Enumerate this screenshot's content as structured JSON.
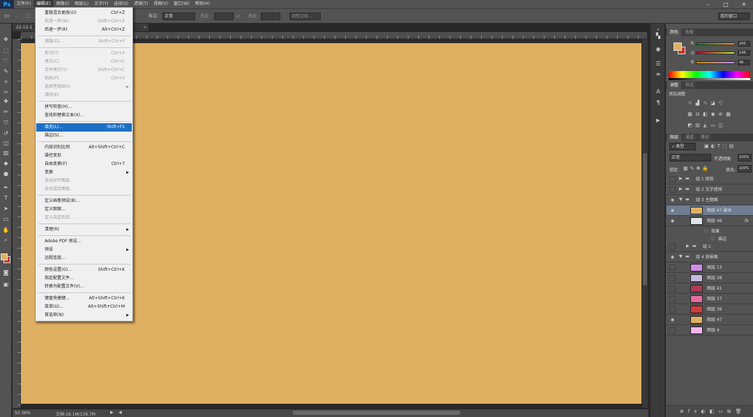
{
  "app": {
    "logo": "Ps"
  },
  "menubar": {
    "items": [
      "文件(F)",
      "编辑(E)",
      "图像(I)",
      "图层(L)",
      "文字(Y)",
      "选择(S)",
      "滤镜(T)",
      "视图(V)",
      "窗口(W)",
      "帮助(H)"
    ],
    "active_index": 1
  },
  "window_controls": [
    "–",
    "□",
    "✕"
  ],
  "options_bar": {
    "style_label": "样式:",
    "style_value": "正常",
    "width_label": "宽度:",
    "height_label": "高度:",
    "refine_label": "调整边缘...",
    "workspace": "我的窗口"
  },
  "document": {
    "tab_label": "22-12-1",
    "zoom": "50.36%",
    "info": "文档:16.1M/139.7M"
  },
  "edit_menu": {
    "sections": [
      [
        {
          "label": "重做混合更改(O)",
          "shortcut": "Ctrl+Z",
          "disabled": false
        },
        {
          "label": "前进一步(W)",
          "shortcut": "Shift+Ctrl+Z",
          "disabled": true
        },
        {
          "label": "后退一步(K)",
          "shortcut": "Alt+Ctrl+Z",
          "disabled": false
        }
      ],
      [
        {
          "label": "渐隐(D)...",
          "shortcut": "Shift+Ctrl+F",
          "disabled": true
        }
      ],
      [
        {
          "label": "剪切(T)",
          "shortcut": "Ctrl+X",
          "disabled": true
        },
        {
          "label": "拷贝(C)",
          "shortcut": "Ctrl+C",
          "disabled": true
        },
        {
          "label": "合并拷贝(Y)",
          "shortcut": "Shift+Ctrl+C",
          "disabled": true
        },
        {
          "label": "粘贴(P)",
          "shortcut": "Ctrl+V",
          "disabled": true
        },
        {
          "label": "选择性粘贴(I)",
          "shortcut": "",
          "submenu": true,
          "disabled": true
        },
        {
          "label": "清除(E)",
          "shortcut": "",
          "disabled": true
        }
      ],
      [
        {
          "label": "拼写检查(H)...",
          "shortcut": "",
          "disabled": false
        },
        {
          "label": "查找和替换文本(X)...",
          "shortcut": "",
          "disabled": false
        }
      ],
      [
        {
          "label": "填充(L)...",
          "shortcut": "Shift+F5",
          "disabled": false,
          "highlighted": true
        },
        {
          "label": "描边(S)...",
          "shortcut": "",
          "disabled": false
        }
      ],
      [
        {
          "label": "内容识别比例",
          "shortcut": "Alt+Shift+Ctrl+C",
          "disabled": false
        },
        {
          "label": "操控变形",
          "shortcut": "",
          "disabled": false
        },
        {
          "label": "自由变换(F)",
          "shortcut": "Ctrl+T",
          "disabled": false
        },
        {
          "label": "变换",
          "shortcut": "",
          "submenu": true,
          "disabled": false
        },
        {
          "label": "自动对齐图层...",
          "shortcut": "",
          "disabled": true
        },
        {
          "label": "自动混合图层...",
          "shortcut": "",
          "disabled": true
        }
      ],
      [
        {
          "label": "定义画笔预设(B)...",
          "shortcut": "",
          "disabled": false
        },
        {
          "label": "定义图案...",
          "shortcut": "",
          "disabled": false
        },
        {
          "label": "定义自定形状...",
          "shortcut": "",
          "disabled": true
        }
      ],
      [
        {
          "label": "清理(R)",
          "shortcut": "",
          "submenu": true,
          "disabled": false
        }
      ],
      [
        {
          "label": "Adobe PDF 预设...",
          "shortcut": "",
          "disabled": false
        },
        {
          "label": "预设",
          "shortcut": "",
          "submenu": true,
          "disabled": false
        },
        {
          "label": "远程连接...",
          "shortcut": "",
          "disabled": false
        }
      ],
      [
        {
          "label": "颜色设置(G)...",
          "shortcut": "Shift+Ctrl+K",
          "disabled": false
        },
        {
          "label": "指定配置文件...",
          "shortcut": "",
          "disabled": false
        },
        {
          "label": "转换为配置文件(V)...",
          "shortcut": "",
          "disabled": false
        }
      ],
      [
        {
          "label": "键盘快捷键...",
          "shortcut": "Alt+Shift+Ctrl+K",
          "disabled": false
        },
        {
          "label": "菜单(U)...",
          "shortcut": "Alt+Shift+Ctrl+M",
          "disabled": false
        },
        {
          "label": "首选项(N)",
          "shortcut": "",
          "submenu": true,
          "disabled": false
        }
      ]
    ]
  },
  "color_panel": {
    "tabs": [
      "颜色",
      "色板"
    ],
    "foreground": "#e0b062",
    "background": "#c0392b",
    "channels": [
      {
        "label": "R",
        "value": "200"
      },
      {
        "label": "G",
        "value": "148"
      },
      {
        "label": "B",
        "value": "46"
      }
    ]
  },
  "adjustments_panel": {
    "tabs": [
      "调整",
      "样式"
    ],
    "title": "添加调整"
  },
  "layers_panel": {
    "tabs": [
      "图层",
      "通道",
      "路径"
    ],
    "filter_label": "类型",
    "blend_mode": "正常",
    "opacity_label": "不透明度:",
    "opacity_value": "100%",
    "lock_label": "锁定:",
    "fill_label": "填充:",
    "fill_value": "100%",
    "layers": [
      {
        "name": "组 1 修剪",
        "type": "group",
        "collapsed": true,
        "indent": 0,
        "visible": false
      },
      {
        "name": "组 2 文字遮挡",
        "type": "group",
        "collapsed": true,
        "indent": 0,
        "visible": false
      },
      {
        "name": "组 3 主题图",
        "type": "group",
        "collapsed": false,
        "indent": 0,
        "visible": true
      },
      {
        "name": "图层 47 副本",
        "type": "layer",
        "indent": 1,
        "visible": true,
        "selected": true,
        "color": "#e0b062"
      },
      {
        "name": "图层 46",
        "type": "layer",
        "indent": 1,
        "visible": true,
        "color": "#dfe3e8",
        "fx": "fx"
      },
      {
        "name": "效果",
        "type": "effect",
        "indent": 2,
        "visible": false
      },
      {
        "name": "描边",
        "type": "effect",
        "indent": 3,
        "visible": false
      },
      {
        "name": "组 1",
        "type": "group",
        "collapsed": true,
        "indent": 1,
        "visible": false
      },
      {
        "name": "组 4 背景图",
        "type": "group",
        "collapsed": false,
        "indent": 0,
        "visible": true
      },
      {
        "name": "图层 13",
        "type": "layer",
        "indent": 1,
        "visible": false,
        "color": "#d48ae8"
      },
      {
        "name": "图层 38",
        "type": "layer",
        "indent": 1,
        "visible": false,
        "color": "#c9b8e0"
      },
      {
        "name": "图层 41",
        "type": "layer",
        "indent": 1,
        "visible": false,
        "color": "#b03a55"
      },
      {
        "name": "图层 37",
        "type": "layer",
        "indent": 1,
        "visible": false,
        "color": "#e86aa0"
      },
      {
        "name": "图层 36",
        "type": "layer",
        "indent": 1,
        "visible": false,
        "color": "#d23c3c"
      },
      {
        "name": "图层 47",
        "type": "layer",
        "indent": 1,
        "visible": true,
        "color": "#e0b062"
      },
      {
        "name": "图层 4",
        "type": "layer",
        "indent": 1,
        "visible": false,
        "color": "#f7b2ee"
      }
    ]
  }
}
